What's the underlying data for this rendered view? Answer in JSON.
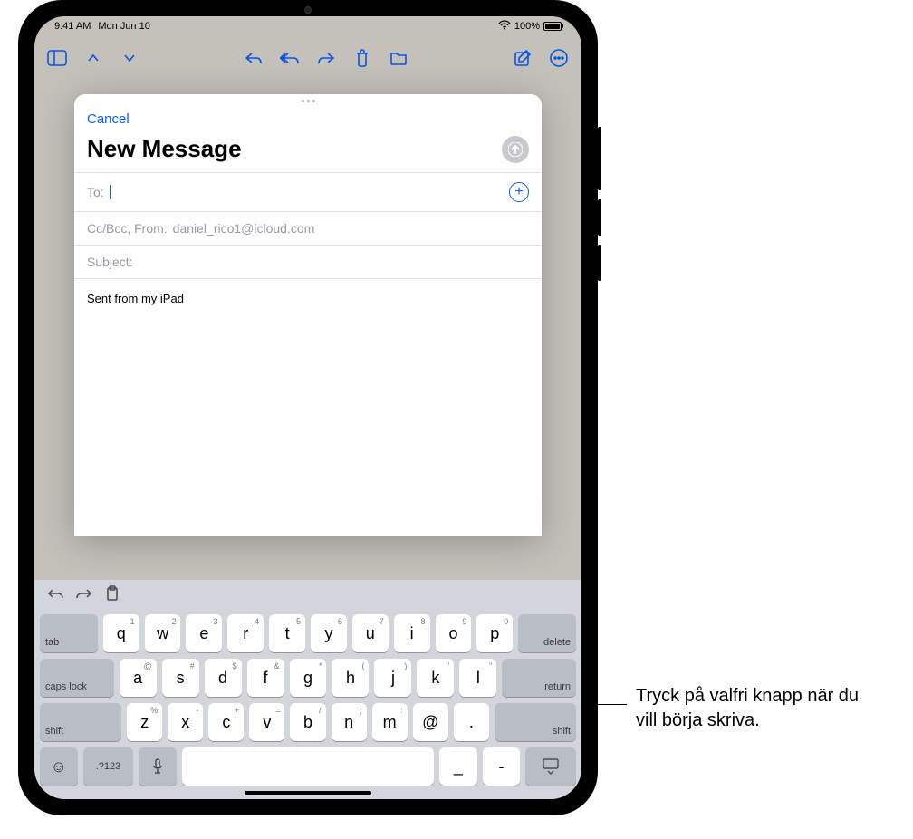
{
  "statusbar": {
    "time": "9:41 AM",
    "date": "Mon Jun 10",
    "battery": "100%"
  },
  "compose": {
    "cancel": "Cancel",
    "title": "New Message",
    "to_label": "To:",
    "ccbcc_label": "Cc/Bcc, From:",
    "from_value": "daniel_rico1@icloud.com",
    "subject_label": "Subject:",
    "body": "Sent from my iPad"
  },
  "keyboard": {
    "row1": [
      {
        "main": "q",
        "alt": "1"
      },
      {
        "main": "w",
        "alt": "2"
      },
      {
        "main": "e",
        "alt": "3"
      },
      {
        "main": "r",
        "alt": "4"
      },
      {
        "main": "t",
        "alt": "5"
      },
      {
        "main": "y",
        "alt": "6"
      },
      {
        "main": "u",
        "alt": "7"
      },
      {
        "main": "i",
        "alt": "8"
      },
      {
        "main": "o",
        "alt": "9"
      },
      {
        "main": "p",
        "alt": "0"
      }
    ],
    "row2": [
      {
        "main": "a",
        "alt": "@"
      },
      {
        "main": "s",
        "alt": "#"
      },
      {
        "main": "d",
        "alt": "$"
      },
      {
        "main": "f",
        "alt": "&"
      },
      {
        "main": "g",
        "alt": "*"
      },
      {
        "main": "h",
        "alt": "("
      },
      {
        "main": "j",
        "alt": ")"
      },
      {
        "main": "k",
        "alt": "'"
      },
      {
        "main": "l",
        "alt": "\""
      }
    ],
    "row3": [
      {
        "main": "z",
        "alt": "%"
      },
      {
        "main": "x",
        "alt": "-"
      },
      {
        "main": "c",
        "alt": "+"
      },
      {
        "main": "v",
        "alt": "="
      },
      {
        "main": "b",
        "alt": "/"
      },
      {
        "main": "n",
        "alt": ";"
      },
      {
        "main": "m",
        "alt": ":"
      },
      {
        "main": "@",
        "alt": ""
      },
      {
        "main": ".",
        "alt": ""
      }
    ],
    "tab": "tab",
    "delete": "delete",
    "caps": "caps lock",
    "return": "return",
    "shift": "shift",
    "numbers": ".?123",
    "under": "_",
    "dash": "-"
  },
  "callout": "Tryck på valfri knapp när du vill börja skriva."
}
